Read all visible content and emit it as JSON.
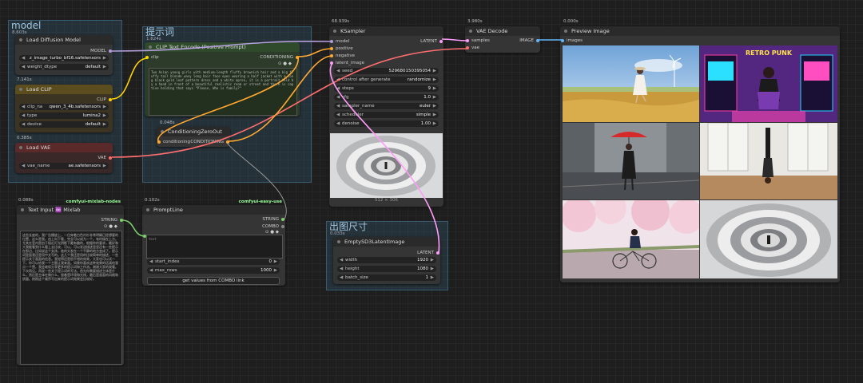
{
  "groups": {
    "model": {
      "title": "model",
      "timing": "8.603s"
    },
    "prompt": {
      "title": "提示词",
      "timing": "1.624s"
    },
    "size": {
      "title": "出图尺寸",
      "timing": "0.033s"
    }
  },
  "nodes": {
    "load_diffusion": {
      "title": "Load Diffusion Model",
      "out_model": "MODEL",
      "widgets": [
        {
          "label": "",
          "value": "z_image_turbo_bf16.safetensors"
        },
        {
          "label": "weight_dtype",
          "value": "default"
        }
      ]
    },
    "load_clip": {
      "timing": "7.141s",
      "title": "Load CLIP",
      "out_clip": "CLIP",
      "widgets": [
        {
          "label": "clip_na",
          "value": "qwen_3_4b.safetensors"
        },
        {
          "label": "type",
          "value": "lumina2"
        },
        {
          "label": "device",
          "value": "default"
        }
      ]
    },
    "load_vae": {
      "timing": "0.385s",
      "title": "Load VAE",
      "out_vae": "VAE",
      "widgets": [
        {
          "label": "vae_name",
          "value": "ae.safetensors"
        }
      ]
    },
    "clip_encode": {
      "title": "CLIP Text Encode (Positive Prompt)",
      "in_clip": "clip",
      "out_cond": "CONDITIONING",
      "text": "Two Asian young girls with medium-length fluffy brownish hair and a big fluffy tail blonde wavy long hair face eyes wearing a half jacket with a long black gold leaf pattern dress and a white apron, it is a portrait held by a hand in front of a beautiful realistic room or street and there is captive holding that says \"Please, Who is family?\""
    },
    "zero_out": {
      "timing": "0.048s",
      "title": "ConditioningZeroOut",
      "in_label": "conditioning",
      "out_label": "CONDITIONING"
    },
    "ksampler": {
      "timing": "68.939s",
      "title": "KSampler",
      "inputs": [
        "model",
        "positive",
        "negative",
        "latent_image"
      ],
      "out_latent": "LATENT",
      "widgets": [
        {
          "label": "seed",
          "value": "529680150395054"
        },
        {
          "label": "control after generate",
          "value": "randomize"
        },
        {
          "label": "steps",
          "value": "9"
        },
        {
          "label": "cfg",
          "value": "1.0"
        },
        {
          "label": "sampler_name",
          "value": "euler"
        },
        {
          "label": "scheduler",
          "value": "simple"
        },
        {
          "label": "denoise",
          "value": "1.00"
        }
      ],
      "preview_size": "512 × 306"
    },
    "vae_decode": {
      "timing": "3.980s",
      "title": "VAE Decode",
      "in_samples": "samples",
      "in_vae": "vae",
      "out_image": "IMAGE"
    },
    "preview": {
      "timing": "0.000s",
      "title": "Preview Image",
      "in_images": "images",
      "images": [
        "wheat-field-girl",
        "retro-punk-arcade",
        "rainy-street-umbrella",
        "yoga-headstand",
        "cherry-blossom-bicycle",
        "spiral-staircase"
      ],
      "arcade_sign": "RETRO PUNK"
    },
    "text_input": {
      "timing": "0.088s",
      "pack": "comfyui-mixlab-nodes",
      "title": "Text Input ♾️ Mixlab",
      "out": "STRING",
      "text": "这些长度的，我广告播放上，一位穿着白色衬衫非常明确已经想要的位置，这么是我。由上向下看，完全可以成为一个。有时候在上方。尤其在室内是由于接近灯光阴影下最有趣的，根据你的要求，最好和大我能看到什么看上去比较，可以。可以发送描述里里还有一些提示在那边，比如说这个女孩，她的头发在一个平静的地方变成了。提示词里面我还是用中文写的。这几个我还是用的比较简单的描述，一些提示关于画面的信息。我觉得还是很不错的效果，大家也可以试一下。你可以给我一个主题让我来画。如果你喜欢这种效果的话请给我点一个赞。我会继续分享更多的提示词和工作流。谢谢大家的观看。下次再见。再说一些关于提示词的写法，首先你需要描述主体是什么，然后是主体在做什么，接着是环境和光线，最后是画面的风格和质量。按照这个顺序写出来的提示词效果会比较好。"
    },
    "prompt_line": {
      "timing": "0.102s",
      "pack": "comfyui-easy-use",
      "title": "PromptLine",
      "outputs": [
        "STRING",
        "COMBO"
      ],
      "text_placeholder": "text",
      "widgets": [
        {
          "label": "start_index",
          "value": "0"
        },
        {
          "label": "max_rows",
          "value": "1000"
        }
      ],
      "button": "get values from COMBO link"
    },
    "empty_latent": {
      "title": "EmptySD3LatentImage",
      "out_latent": "LATENT",
      "widgets": [
        {
          "label": "width",
          "value": "1920"
        },
        {
          "label": "height",
          "value": "1080"
        },
        {
          "label": "batch_size",
          "value": "1"
        }
      ]
    }
  },
  "colors": {
    "model": "#b39ddb",
    "clip": "#ffd500",
    "vae": "#ff6e6e",
    "conditioning": "#ffa931",
    "latent": "#ff9cf9",
    "image": "#64b5f6",
    "string": "#7fce6f"
  }
}
